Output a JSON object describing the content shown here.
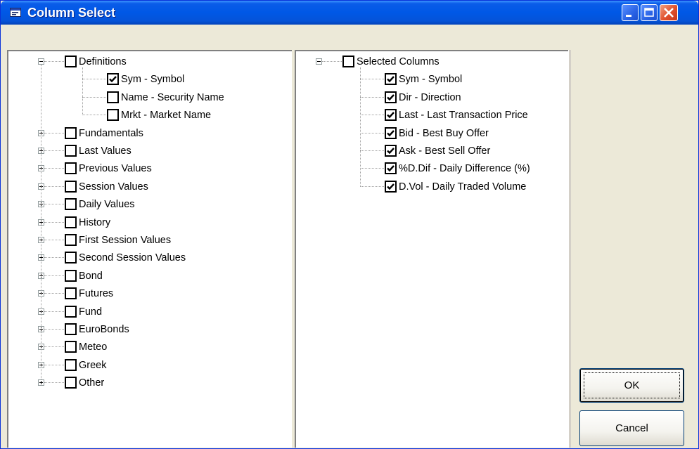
{
  "window": {
    "title": "Column Select"
  },
  "left_tree": {
    "root": {
      "label": "Definitions",
      "checked": false,
      "expanded": true,
      "children": [
        {
          "label": "Sym - Symbol",
          "checked": true
        },
        {
          "label": "Name - Security Name",
          "checked": false
        },
        {
          "label": "Mrkt - Market Name",
          "checked": false
        }
      ]
    },
    "groups": [
      "Fundamentals",
      "Last Values",
      "Previous Values",
      "Session Values",
      "Daily Values",
      "History",
      "First Session Values",
      "Second Session Values",
      "Bond",
      "Futures",
      "Fund",
      "EuroBonds",
      "Meteo",
      "Greek",
      "Other"
    ]
  },
  "right_tree": {
    "root": {
      "label": "Selected Columns",
      "checked": false,
      "expanded": true,
      "children": [
        {
          "label": "Sym - Symbol",
          "checked": true
        },
        {
          "label": "Dir - Direction",
          "checked": true
        },
        {
          "label": "Last - Last Transaction Price",
          "checked": true
        },
        {
          "label": "Bid - Best Buy Offer",
          "checked": true
        },
        {
          "label": "Ask - Best Sell Offer",
          "checked": true
        },
        {
          "label": "%D.Dif - Daily Difference (%)",
          "checked": true
        },
        {
          "label": "D.Vol - Daily Traded Volume",
          "checked": true
        }
      ]
    }
  },
  "buttons": {
    "ok": "OK",
    "cancel": "Cancel"
  }
}
